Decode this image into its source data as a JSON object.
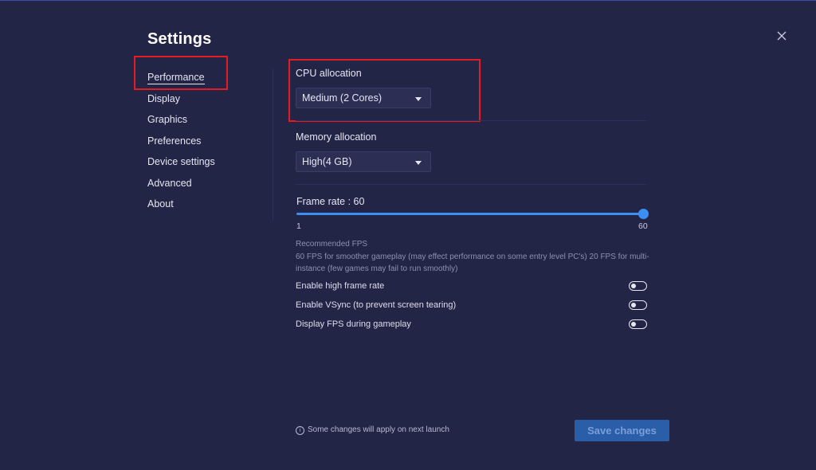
{
  "settings": {
    "title": "Settings"
  },
  "nav": {
    "items": [
      {
        "label": "Performance",
        "active": true
      },
      {
        "label": "Display"
      },
      {
        "label": "Graphics"
      },
      {
        "label": "Preferences"
      },
      {
        "label": "Device settings"
      },
      {
        "label": "Advanced"
      },
      {
        "label": "About"
      }
    ]
  },
  "cpu": {
    "label": "CPU allocation",
    "value": "Medium (2 Cores)"
  },
  "memory": {
    "label": "Memory allocation",
    "value": "High(4 GB)"
  },
  "frame_rate": {
    "label": "Frame rate : 60",
    "min_label": "1",
    "max_label": "60",
    "value": 60,
    "min": 1,
    "max": 60
  },
  "recommended": {
    "title": "Recommended FPS",
    "text": "60 FPS for smoother gameplay (may effect performance on some entry level PC's) 20 FPS for multi-instance (few games may fail to run smoothly)"
  },
  "toggles": [
    {
      "label": "Enable high frame rate",
      "on": false
    },
    {
      "label": "Enable VSync (to prevent screen tearing)",
      "on": false
    },
    {
      "label": "Display FPS during gameplay",
      "on": false
    }
  ],
  "footer": {
    "note": "Some changes will apply on next launch",
    "save_label": "Save changes"
  },
  "colors": {
    "background": "#232546",
    "accent": "#3c8ef0",
    "highlight": "#e41b23",
    "save_button": "#2a5ea9"
  }
}
